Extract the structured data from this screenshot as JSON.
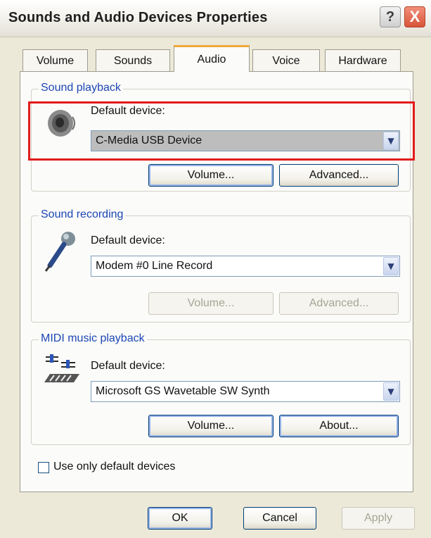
{
  "window": {
    "title": "Sounds and Audio Devices Properties"
  },
  "titlebar": {
    "help_label": "?",
    "close_label": "X"
  },
  "tabs": [
    {
      "label": "Volume"
    },
    {
      "label": "Sounds"
    },
    {
      "label": "Audio"
    },
    {
      "label": "Voice"
    },
    {
      "label": "Hardware"
    }
  ],
  "active_tab": "Audio",
  "sound_playback": {
    "group_label": "Sound playback",
    "icon": "speaker-icon",
    "default_device_label": "Default device:",
    "selected_device": "C-Media USB Device",
    "volume_button": "Volume...",
    "advanced_button": "Advanced..."
  },
  "sound_recording": {
    "group_label": "Sound recording",
    "icon": "microphone-icon",
    "default_device_label": "Default device:",
    "selected_device": "Modem #0 Line Record",
    "volume_button": "Volume...",
    "advanced_button": "Advanced..."
  },
  "midi_playback": {
    "group_label": "MIDI music playback",
    "icon": "midi-keyboard-icon",
    "default_device_label": "Default device:",
    "selected_device": "Microsoft GS Wavetable SW Synth",
    "volume_button": "Volume...",
    "about_button": "About..."
  },
  "use_default_only": {
    "label": "Use only default devices",
    "checked": false
  },
  "footer": {
    "ok": "OK",
    "cancel": "Cancel",
    "apply": "Apply"
  },
  "colors": {
    "highlight_box": "#e21b1b",
    "group_label": "#1c46b5",
    "active_tab_accent": "#f2a93b"
  }
}
